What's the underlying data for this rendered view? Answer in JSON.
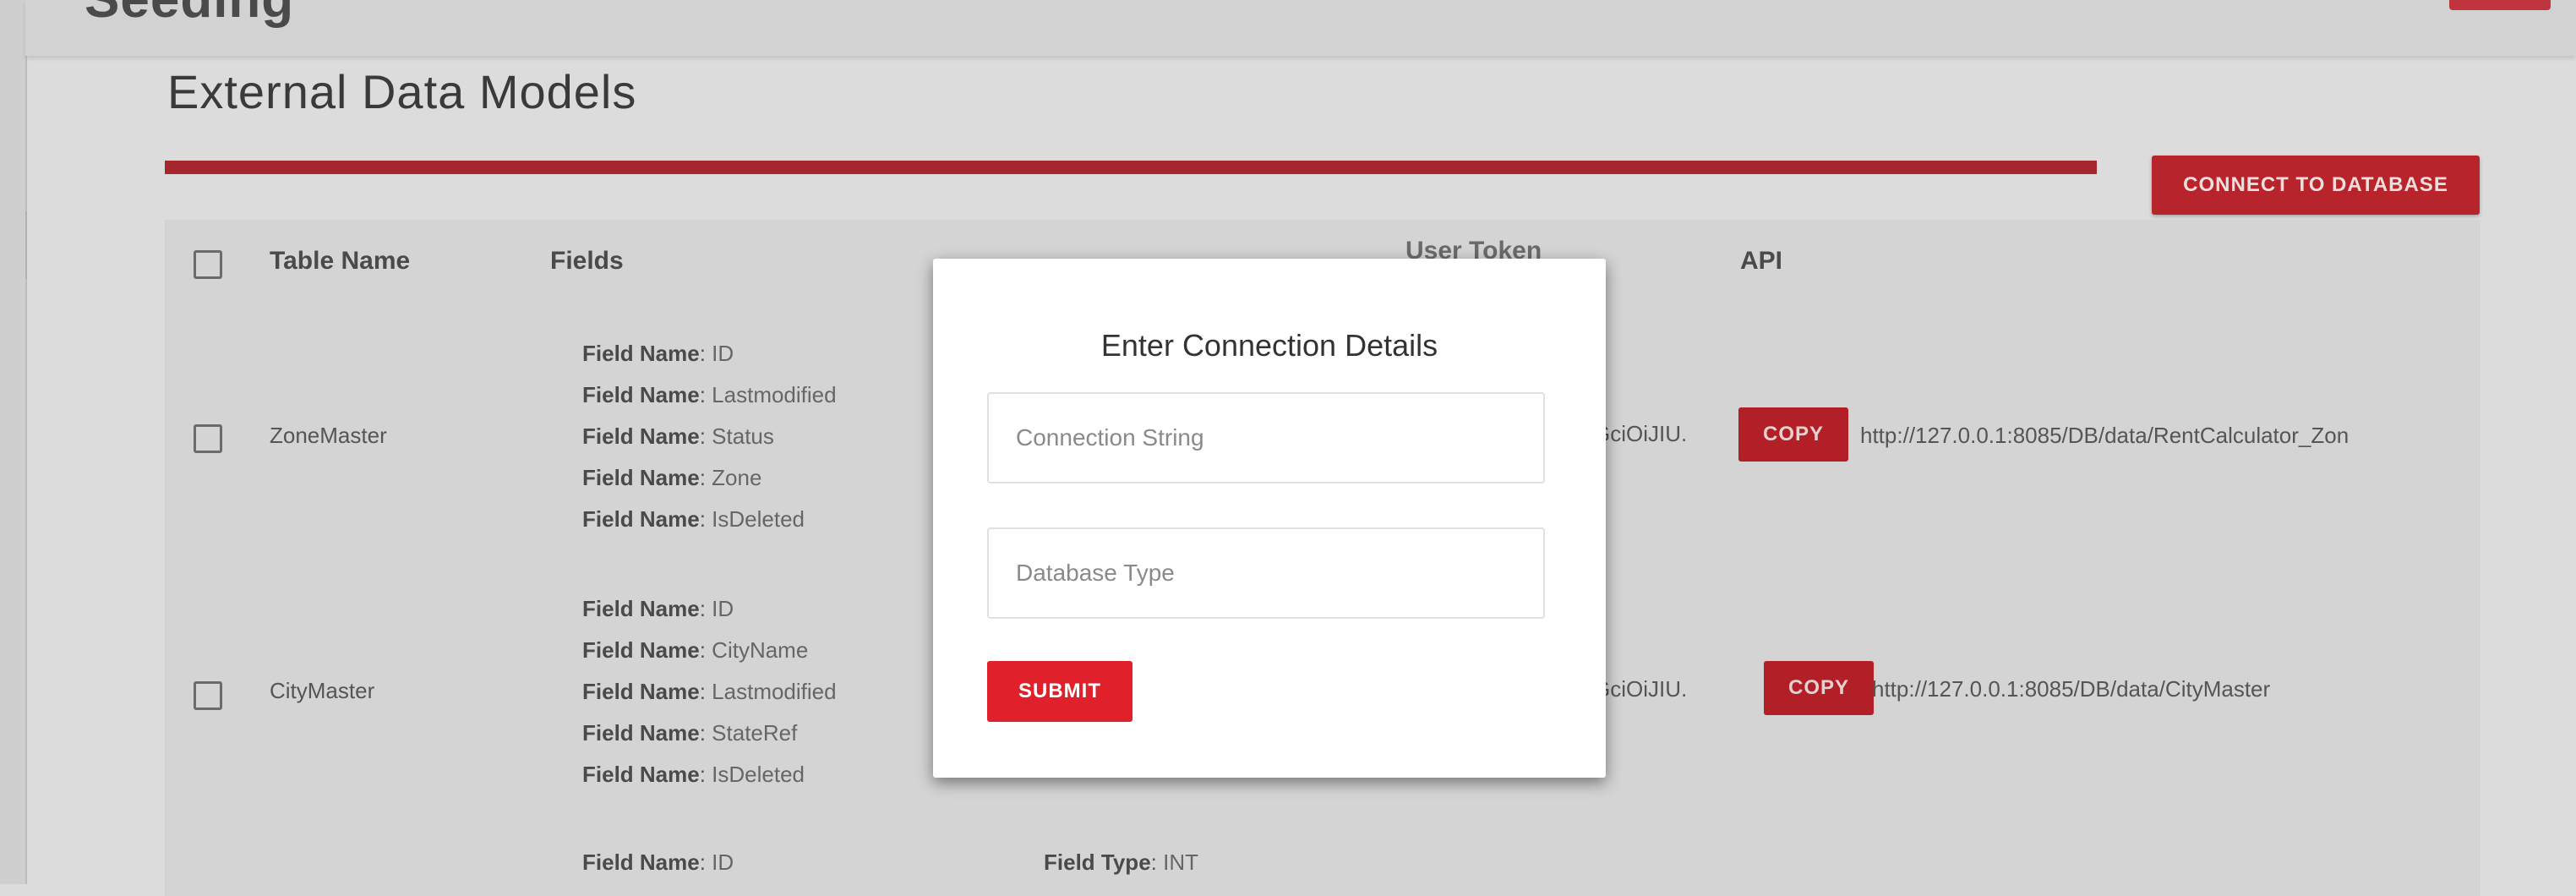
{
  "brand": "Seeding",
  "page": {
    "title": "External Data Models",
    "connect_button": "CONNECT TO DATABASE"
  },
  "table": {
    "headers": {
      "table_name": "Table Name",
      "fields": "Fields",
      "user_token": "User Token",
      "api": "API"
    },
    "rows": [
      {
        "name": "ZoneMaster",
        "fields": [
          "ID",
          "Lastmodified",
          "Status",
          "Zone",
          "IsDeleted"
        ],
        "token": "GciOiJIU.",
        "copy_label": "COPY",
        "api_url": "http://127.0.0.1:8085/DB/data/RentCalculator_Zon"
      },
      {
        "name": "CityMaster",
        "fields": [
          "ID",
          "CityName",
          "Lastmodified",
          "StateRef",
          "IsDeleted"
        ],
        "token": "GciOiJIU.",
        "copy_label": "COPY",
        "api_url": "http://127.0.0.1:8085/DB/data/CityMaster"
      },
      {
        "field_name": "ID",
        "field_type": "INT"
      }
    ],
    "field_name_label": "Field Name",
    "field_type_label": "Field Type"
  },
  "modal": {
    "title": "Enter Connection Details",
    "connection_string_placeholder": "Connection String",
    "database_type_placeholder": "Database Type",
    "submit_label": "SUBMIT"
  },
  "colors": {
    "accent": "#e0202a",
    "accent_dim": "#b21f26",
    "overlay_bg": "#dcdcdc"
  }
}
